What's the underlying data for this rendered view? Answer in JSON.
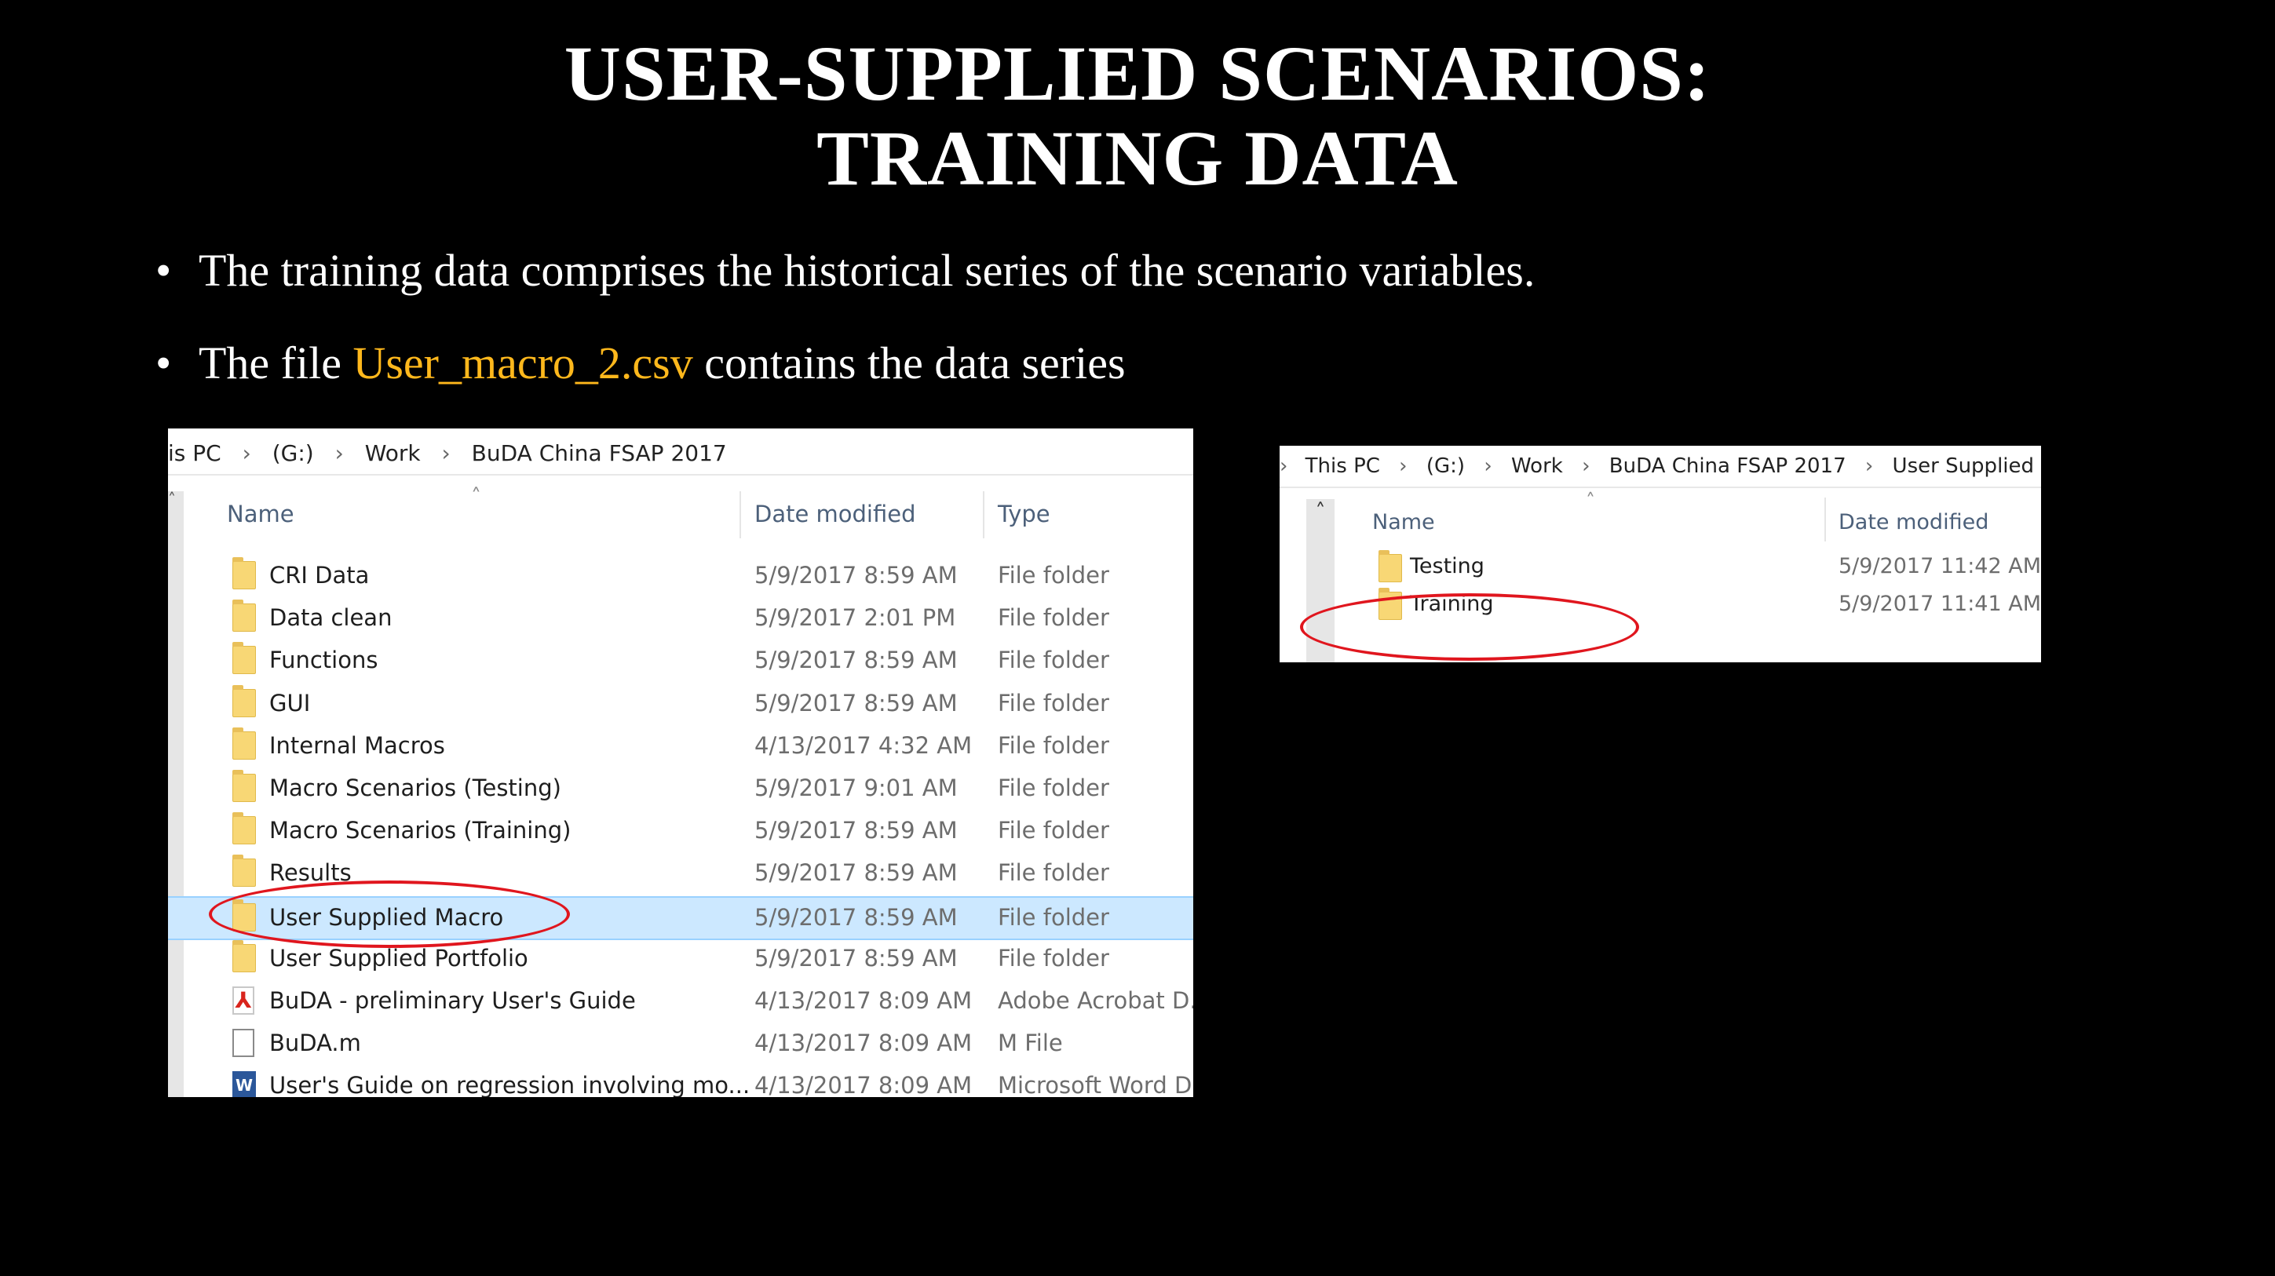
{
  "title": {
    "line1": "USER-SUPPLIED SCENARIOS:",
    "line2": "TRAINING DATA"
  },
  "bullets": [
    {
      "text": "The training data comprises the historical series of the scenario variables."
    },
    {
      "prefix": "The file ",
      "highlight": "User_macro_2.csv",
      "suffix": " contains the data series"
    }
  ],
  "colors": {
    "highlight": "#FFB81C",
    "annotation": "#E0161E",
    "selected_row": "#CCE8FF"
  },
  "explorer_main": {
    "breadcrumb": [
      "is PC",
      "(G:)",
      "Work",
      "BuDA China FSAP 2017"
    ],
    "columns": {
      "name": "Name",
      "date": "Date modified",
      "type": "Type"
    },
    "rows": [
      {
        "name": "CRI Data",
        "date": "5/9/2017 8:59 AM",
        "type": "File folder",
        "icon": "folder-icon"
      },
      {
        "name": "Data clean",
        "date": "5/9/2017 2:01 PM",
        "type": "File folder",
        "icon": "folder-icon"
      },
      {
        "name": "Functions",
        "date": "5/9/2017 8:59 AM",
        "type": "File folder",
        "icon": "folder-icon"
      },
      {
        "name": "GUI",
        "date": "5/9/2017 8:59 AM",
        "type": "File folder",
        "icon": "folder-icon"
      },
      {
        "name": "Internal Macros",
        "date": "4/13/2017 4:32 AM",
        "type": "File folder",
        "icon": "folder-icon"
      },
      {
        "name": "Macro Scenarios (Testing)",
        "date": "5/9/2017 9:01 AM",
        "type": "File folder",
        "icon": "folder-icon"
      },
      {
        "name": "Macro Scenarios (Training)",
        "date": "5/9/2017 8:59 AM",
        "type": "File folder",
        "icon": "folder-icon"
      },
      {
        "name": "Results",
        "date": "5/9/2017 8:59 AM",
        "type": "File folder",
        "icon": "folder-icon"
      },
      {
        "name": "User Supplied Macro",
        "date": "5/9/2017 8:59 AM",
        "type": "File folder",
        "icon": "folder-icon",
        "selected": true
      },
      {
        "name": "User Supplied Portfolio",
        "date": "5/9/2017 8:59 AM",
        "type": "File folder",
        "icon": "folder-icon"
      },
      {
        "name": "BuDA - preliminary User's Guide",
        "date": "4/13/2017 8:09 AM",
        "type": "Adobe Acrobat D...",
        "icon": "pdf-icon"
      },
      {
        "name": "BuDA.m",
        "date": "4/13/2017 8:09 AM",
        "type": "M File",
        "icon": "file-icon"
      },
      {
        "name": "User's Guide on regression involving mo...",
        "date": "4/13/2017 8:09 AM",
        "type": "Microsoft Word D...",
        "icon": "word-icon"
      }
    ]
  },
  "explorer_sub": {
    "breadcrumb": [
      "This PC",
      "(G:)",
      "Work",
      "BuDA China FSAP 2017",
      "User Supplied Macro"
    ],
    "columns": {
      "name": "Name",
      "date": "Date modified"
    },
    "rows": [
      {
        "name": "Testing",
        "date": "5/9/2017 11:42 AM",
        "icon": "folder-icon"
      },
      {
        "name": "Training",
        "date": "5/9/2017 11:41 AM",
        "icon": "folder-icon"
      }
    ]
  }
}
